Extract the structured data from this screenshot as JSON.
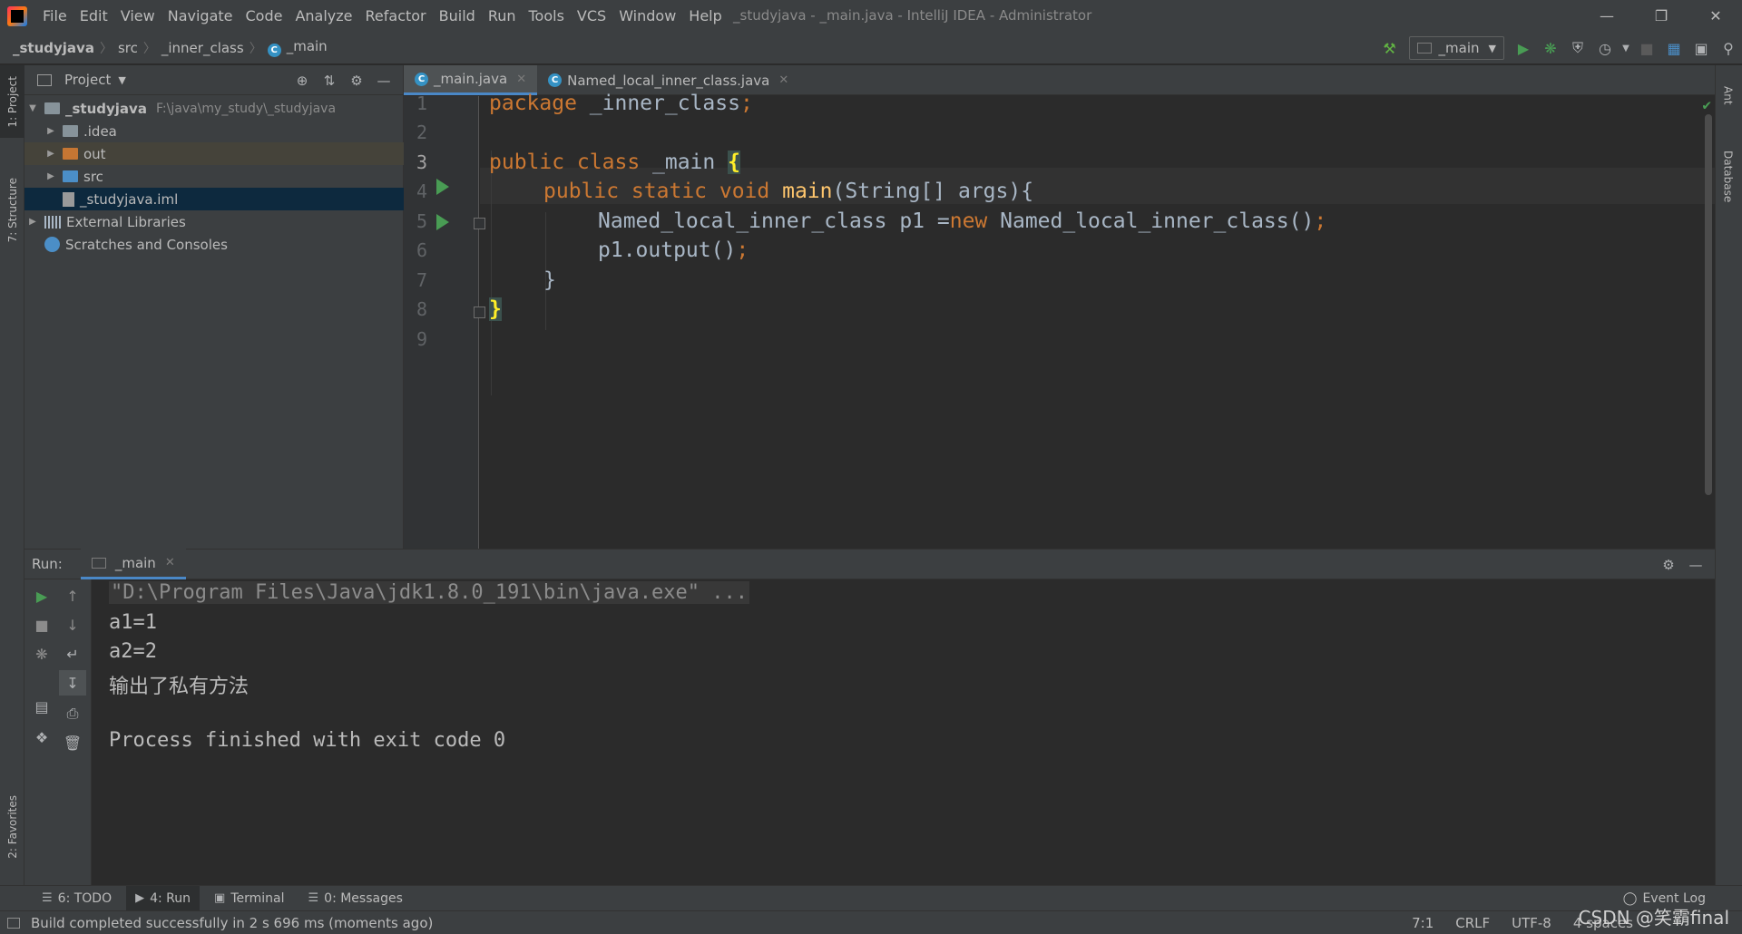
{
  "menu": {
    "items": [
      "File",
      "Edit",
      "View",
      "Navigate",
      "Code",
      "Analyze",
      "Refactor",
      "Build",
      "Run",
      "Tools",
      "VCS",
      "Window",
      "Help"
    ],
    "window_title": "_studyjava - _main.java - IntelliJ IDEA - Administrator"
  },
  "breadcrumb": [
    "_studyjava",
    "src",
    "_inner_class",
    "_main"
  ],
  "run_config": {
    "label": "_main"
  },
  "left_strip": {
    "project": "1: Project",
    "structure": "7: Structure",
    "favorites": "2: Favorites"
  },
  "right_strip": {
    "ant": "Ant",
    "database": "Database"
  },
  "project": {
    "title": "Project",
    "tree": [
      {
        "label": "_studyjava",
        "path": "F:\\java\\my_study\\_studyjava"
      },
      {
        "label": ".idea"
      },
      {
        "label": "out"
      },
      {
        "label": "src"
      },
      {
        "label": "_studyjava.iml"
      },
      {
        "label": "External Libraries"
      },
      {
        "label": "Scratches and Consoles"
      }
    ]
  },
  "editor": {
    "tabs": [
      {
        "label": "_main.java",
        "active": true
      },
      {
        "label": "Named_local_inner_class.java",
        "active": false
      }
    ],
    "line_numbers": [
      "1",
      "2",
      "3",
      "4",
      "5",
      "6",
      "7",
      "8",
      "9"
    ],
    "code": {
      "l1_kw": "package",
      "l1_rest": " _inner_class",
      "l1_semi": ";",
      "l3_kw": "public class",
      "l3_name": " _main ",
      "l3_brace": "{",
      "l4_kw": "public static void",
      "l4_fn": "main",
      "l4_rest": "(String[] args){",
      "l5_a": "Named_local_inner_class p1 =",
      "l5_kw": "new",
      "l5_b": " Named_local_inner_class()",
      "l5_semi": ";",
      "l6_a": "p1.output()",
      "l6_semi": ";",
      "l7": "}",
      "l8": "}"
    }
  },
  "run": {
    "title": "Run:",
    "tab_label": "_main",
    "console": [
      "\"D:\\Program Files\\Java\\jdk1.8.0_191\\bin\\java.exe\" ...",
      "a1=1",
      "a2=2",
      "输出了私有方法",
      "",
      "Process finished with exit code 0"
    ]
  },
  "tool_tabs": [
    {
      "label": "6: TODO"
    },
    {
      "label": "4: Run"
    },
    {
      "label": "Terminal"
    },
    {
      "label": "0: Messages"
    }
  ],
  "event_log": "Event Log",
  "status": {
    "message": "Build completed successfully in 2 s 696 ms (moments ago)",
    "position": "7:1",
    "line_sep": "CRLF",
    "encoding": "UTF-8",
    "indent": "4 spaces"
  },
  "watermark": "CSDN @笑霸final",
  "colors": {
    "keyword": "#cc7832",
    "function": "#ffc66d",
    "run_green": "#499c54",
    "accent": "#4a88c7"
  }
}
